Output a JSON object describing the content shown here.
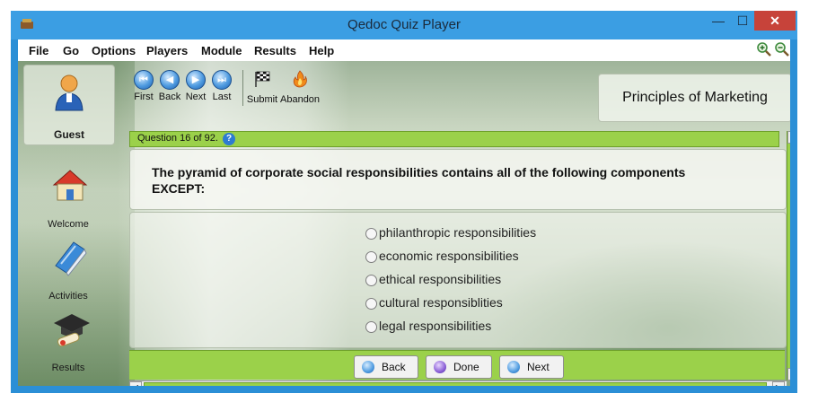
{
  "window": {
    "title": "Qedoc Quiz Player",
    "minimize_glyph": "—",
    "maximize_glyph": "☐",
    "close_glyph": "✕"
  },
  "menu": {
    "items": [
      "File",
      "Go",
      "Options",
      "Players",
      "Module",
      "Results",
      "Help"
    ]
  },
  "zoom": {
    "icons": [
      "zoom-in-icon",
      "zoom-out-icon"
    ]
  },
  "sidebar": {
    "user": {
      "label": "Guest",
      "icon": "user-icon"
    },
    "items": [
      {
        "label": "Welcome",
        "icon": "house-icon"
      },
      {
        "label": "Activities",
        "icon": "book-icon"
      },
      {
        "label": "Results",
        "icon": "graduation-cap-icon"
      }
    ]
  },
  "toolbar": {
    "nav": [
      {
        "label": "First",
        "glyph": "⏮"
      },
      {
        "label": "Back",
        "glyph": "◀"
      },
      {
        "label": "Next",
        "glyph": "▶"
      },
      {
        "label": "Last",
        "glyph": "⏭"
      }
    ],
    "submit_label": "Submit",
    "abandon_label": "Abandon"
  },
  "course": {
    "title": "Principles of Marketing"
  },
  "question": {
    "header": "Question 16 of 92.",
    "help_glyph": "?",
    "text": "The pyramid of corporate social responsibilities contains all of the following components EXCEPT:",
    "options": [
      "philanthropic responsibilities",
      "economic responsibilities",
      "ethical responsibilities",
      "cultural responsiblities",
      "legal responsibilities"
    ]
  },
  "footer": {
    "back_label": "Back",
    "done_label": "Done",
    "next_label": "Next"
  },
  "colors": {
    "accent_green": "#9bd14a",
    "titlebar_blue": "#3b9ee3",
    "close_red": "#c7433a"
  }
}
